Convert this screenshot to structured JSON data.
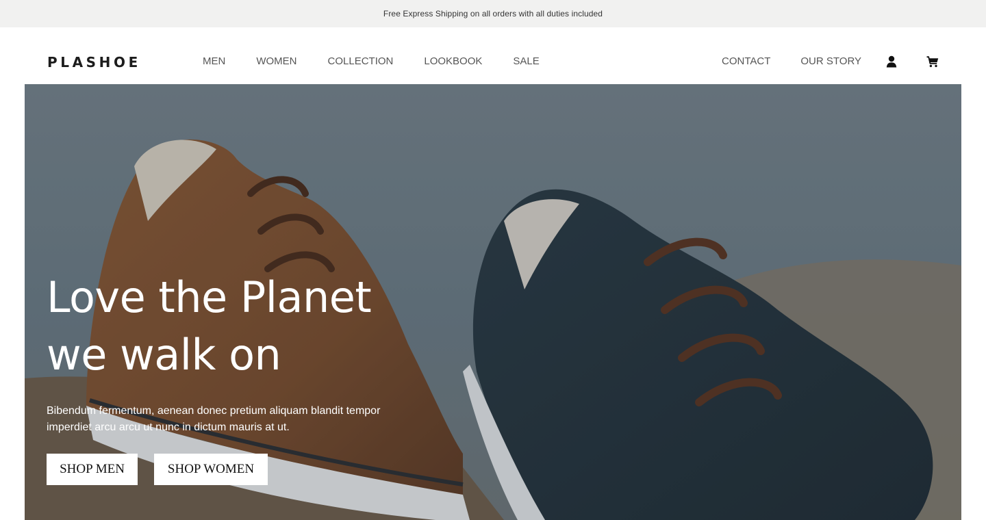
{
  "announcement": {
    "text": "Free Express Shipping on all orders with all duties included"
  },
  "header": {
    "logo": "PLASHOE",
    "nav_left": [
      {
        "label": "MEN"
      },
      {
        "label": "WOMEN"
      },
      {
        "label": "COLLECTION"
      },
      {
        "label": "LOOKBOOK"
      },
      {
        "label": "SALE"
      }
    ],
    "nav_right": [
      {
        "label": "CONTACT"
      },
      {
        "label": "OUR STORY"
      }
    ],
    "icons": {
      "account": "user-icon",
      "cart": "cart-icon"
    }
  },
  "hero": {
    "title_line1": "Love the Planet",
    "title_line2": "we walk on",
    "text": "Bibendum fermentum, aenean donec pretium aliquam blandit tempor imperdiet arcu arcu ut nunc in dictum mauris at ut.",
    "buttons": {
      "shop_men": "SHOP MEN",
      "shop_women": "SHOP WOMEN"
    }
  },
  "colors": {
    "announcement_bg": "#f1f1f0",
    "text_dark": "#1c1c1c",
    "nav_text": "#555555",
    "button_bg": "#ffffff"
  }
}
